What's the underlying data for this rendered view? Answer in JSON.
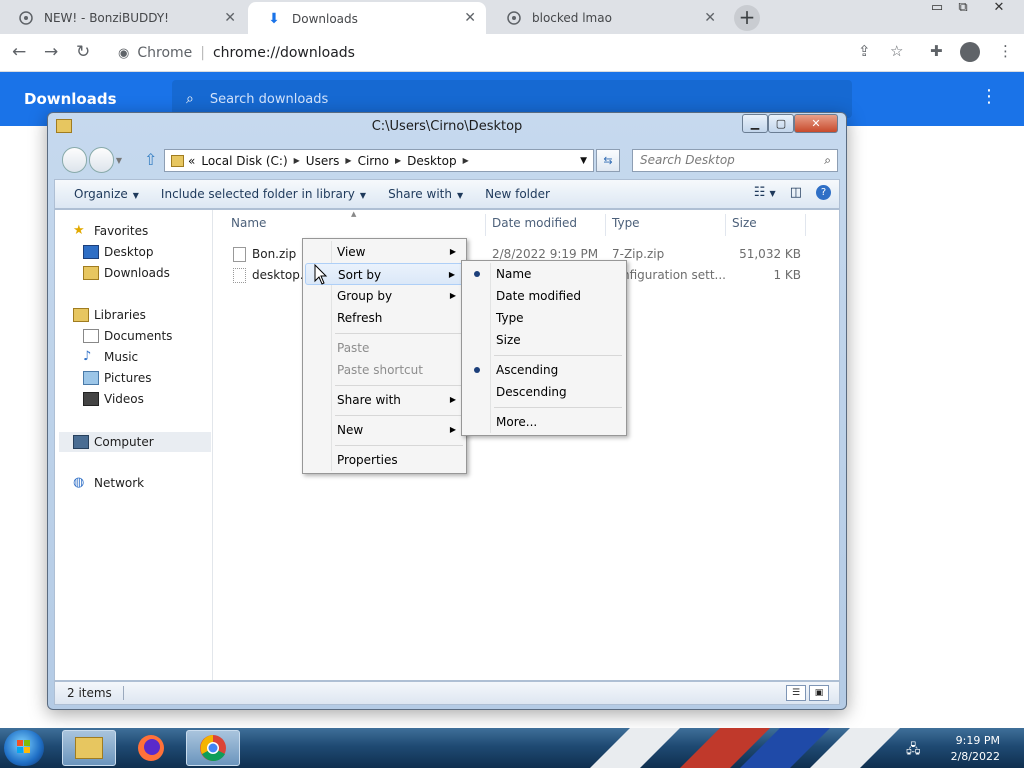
{
  "browser": {
    "tabs": [
      {
        "title": "NEW! - BonziBUDDY!",
        "icon": "globe-icon"
      },
      {
        "title": "Downloads",
        "icon": "download-icon"
      },
      {
        "title": "blocked lmao",
        "icon": "globe-icon"
      }
    ],
    "omnibox": {
      "site": "Chrome",
      "url": "chrome://downloads"
    }
  },
  "downloads_page": {
    "title": "Downloads",
    "search_placeholder": "Search downloads"
  },
  "explorer": {
    "title": "C:\\Users\\Cirno\\Desktop",
    "breadcrumb": [
      "Local Disk (C:)",
      "Users",
      "Cirno",
      "Desktop"
    ],
    "breadcrumb_prefix": "«",
    "search_placeholder": "Search Desktop",
    "commands": [
      {
        "label": "Organize",
        "dropdown": true
      },
      {
        "label": "Include selected folder in library",
        "dropdown": true
      },
      {
        "label": "Share with",
        "dropdown": true
      },
      {
        "label": "New folder",
        "dropdown": false
      }
    ],
    "nav": {
      "favorites_header": "Favorites",
      "favorites": [
        "Desktop",
        "Downloads"
      ],
      "libraries_header": "Libraries",
      "libraries": [
        "Documents",
        "Music",
        "Pictures",
        "Videos"
      ],
      "computer": "Computer",
      "network": "Network"
    },
    "columns": [
      "Name",
      "Date modified",
      "Type",
      "Size"
    ],
    "files": [
      {
        "name": "Bon.zip",
        "modified": "2/8/2022 9:19 PM",
        "type": "7-Zip.zip",
        "size": "51,032 KB"
      },
      {
        "name": "desktop.i",
        "modified": "",
        "type": "nfiguration sett...",
        "size": "1 KB"
      }
    ],
    "status": "2 items"
  },
  "context_menu": {
    "items": [
      "View",
      "Sort by",
      "Group by",
      "Refresh",
      "Paste",
      "Paste shortcut",
      "Share with",
      "New",
      "Properties"
    ]
  },
  "sort_submenu": {
    "fields": [
      "Name",
      "Date modified",
      "Type",
      "Size"
    ],
    "orders": [
      "Ascending",
      "Descending"
    ],
    "more": "More...",
    "selected_field": "Name",
    "selected_order": "Ascending"
  },
  "taskbar": {
    "time": "9:19 PM",
    "date": "2/8/2022"
  },
  "colors": {
    "chrome_blue": "#1a73e8",
    "taskbar": "#1f4a73"
  }
}
